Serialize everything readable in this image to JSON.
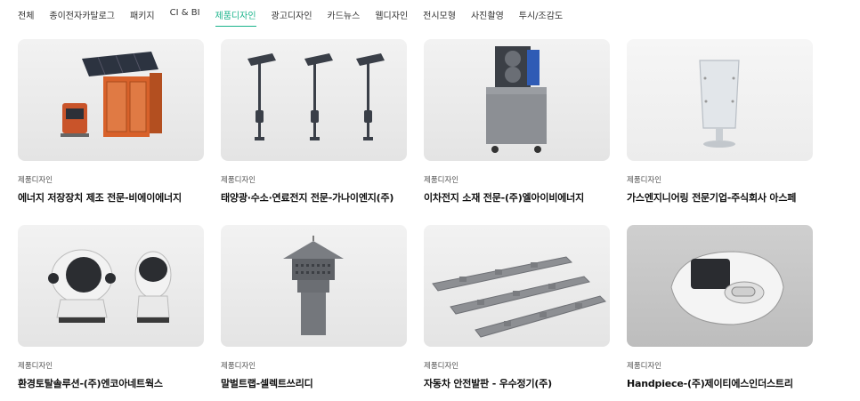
{
  "tabs": [
    {
      "label": "전체",
      "active": false
    },
    {
      "label": "종이전자카탈로그",
      "active": false
    },
    {
      "label": "패키지",
      "active": false
    },
    {
      "label": "CI & BI",
      "active": false
    },
    {
      "label": "제품디자인",
      "active": true
    },
    {
      "label": "광고디자인",
      "active": false
    },
    {
      "label": "카드뉴스",
      "active": false
    },
    {
      "label": "웹디자인",
      "active": false
    },
    {
      "label": "전시모형",
      "active": false
    },
    {
      "label": "사진촬영",
      "active": false
    },
    {
      "label": "투시/조감도",
      "active": false
    }
  ],
  "cards": [
    {
      "category": "제품디자인",
      "title": "에너지 저장장치 제조 전문-비에이에너지",
      "image": "energy-storage-unit"
    },
    {
      "category": "제품디자인",
      "title": "태양광·수소·연료전지 전문-가나이엔지(주)",
      "image": "solar-street-lights"
    },
    {
      "category": "제품디자인",
      "title": "이차전지 소재 전문-(주)엘아이비에너지",
      "image": "roll-press-machine"
    },
    {
      "category": "제품디자인",
      "title": "가스엔지니어링 전문기업-주식회사 아스페",
      "image": "glass-cylinder"
    },
    {
      "category": "제품디자인",
      "title": "환경토탈솔루션-(주)엔코아네트웍스",
      "image": "robot-devices"
    },
    {
      "category": "제품디자인",
      "title": "말벌트랩-셀렉트쓰리디",
      "image": "hornet-trap"
    },
    {
      "category": "제품디자인",
      "title": "자동차 안전발판 - 우수정기(주)",
      "image": "safety-step-plates"
    },
    {
      "category": "제품디자인",
      "title": "Handpiece-(주)제이티에스인더스트리",
      "image": "handpiece-device"
    }
  ]
}
